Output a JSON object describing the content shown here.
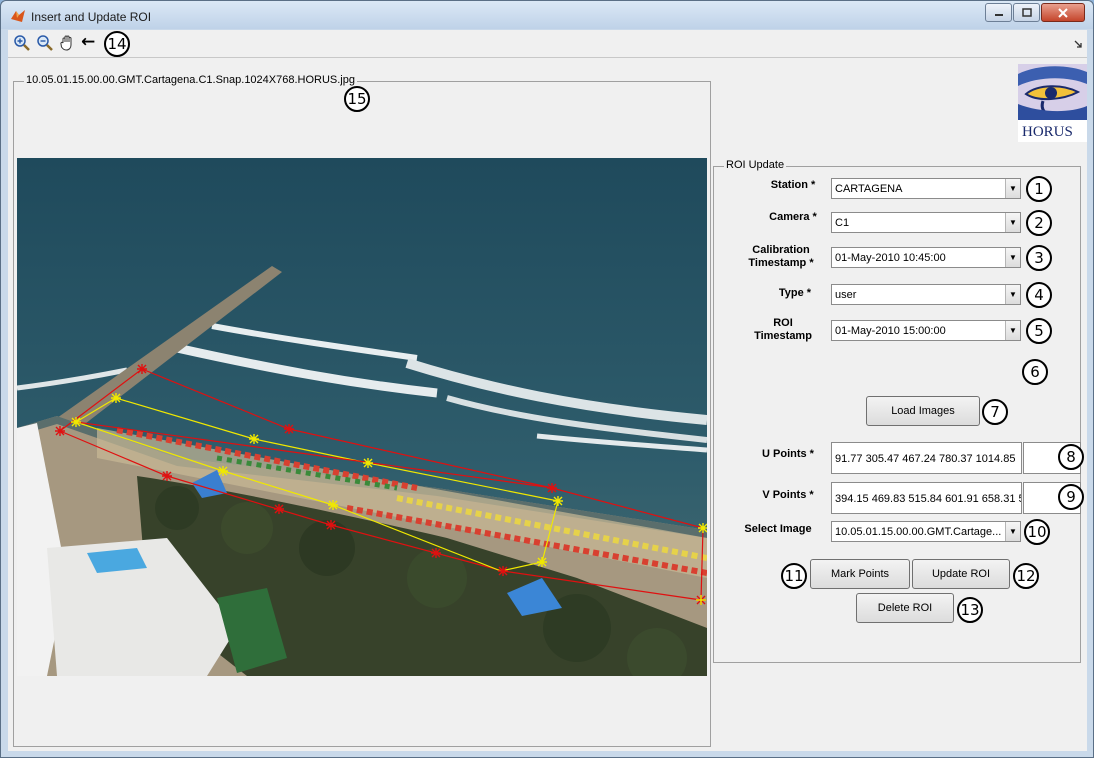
{
  "window": {
    "title": "Insert and Update ROI"
  },
  "toolbar": {
    "icons": [
      "zoom-in-icon",
      "zoom-out-icon",
      "pan-hand-icon"
    ],
    "arrow_glyph": "←",
    "callout": "14"
  },
  "image_panel": {
    "title": "10.05.01.15.00.00.GMT.Cartagena.C1.Snap.1024X768.HORUS.jpg",
    "callout": "15"
  },
  "logo": {
    "text": "HORUS"
  },
  "roi_panel": {
    "title": "ROI Update",
    "station": {
      "label": "Station *",
      "value": "CARTAGENA",
      "callout": "1"
    },
    "camera": {
      "label": "Camera *",
      "value": "C1",
      "callout": "2"
    },
    "calibration": {
      "label_line1": "Calibration",
      "label_line2": "Timestamp *",
      "value": "01-May-2010 10:45:00",
      "callout": "3"
    },
    "type": {
      "label": "Type *",
      "value": "user",
      "callout": "4"
    },
    "roi_timestamp": {
      "label_line1": "ROI",
      "label_line2": "Timestamp",
      "value": "01-May-2010 15:00:00",
      "callout": "5"
    },
    "callout6": "6",
    "load_images": {
      "label": "Load Images",
      "callout": "7"
    },
    "u_points": {
      "label": "U Points *",
      "value": "91.77  305.47  467.24  780.37 1014.85",
      "callout": "8"
    },
    "v_points": {
      "label": "V Points *",
      "value": "394.15 469.83 515.84 601.91 658.31 5",
      "callout": "9"
    },
    "select_image": {
      "label": "Select Image",
      "value": "10.05.01.15.00.00.GMT.Cartage...",
      "callout": "10"
    },
    "mark_points": {
      "label": "Mark Points",
      "callout": "11"
    },
    "update_roi": {
      "label": "Update ROI",
      "callout": "12"
    },
    "delete_roi": {
      "label": "Delete ROI",
      "callout": "13"
    }
  },
  "colors": {
    "roi_red": "#e01010",
    "roi_yellow": "#f0e800",
    "sea": "#2f5a6a",
    "sand": "#a89a82"
  }
}
